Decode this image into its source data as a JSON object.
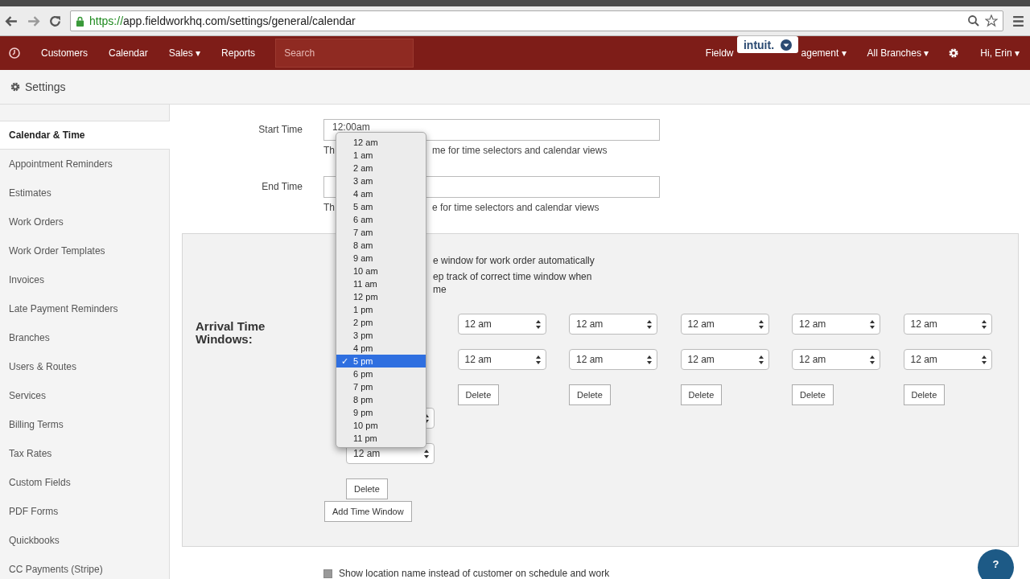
{
  "browser": {
    "url_scheme": "https://",
    "url_rest": "app.fieldworkhq.com/settings/general/calendar"
  },
  "nav": {
    "left": [
      {
        "label": "Customers",
        "caret": false
      },
      {
        "label": "Calendar",
        "caret": false
      },
      {
        "label": "Sales",
        "caret": true
      },
      {
        "label": "Reports",
        "caret": false
      }
    ],
    "search": {
      "placeholder": "Search"
    },
    "covered_left": "Fieldw",
    "covered_right": "agement",
    "right": [
      {
        "label": "All Branches",
        "caret": true
      }
    ],
    "user": "Hi, Erin",
    "caret": "▾",
    "badge": "intuit."
  },
  "header": {
    "title": "Settings"
  },
  "sidebar": {
    "items": [
      {
        "label": "Calendar & Time",
        "selected": true
      },
      {
        "label": "Appointment Reminders",
        "selected": false
      },
      {
        "label": "Estimates",
        "selected": false
      },
      {
        "label": "Work Orders",
        "selected": false
      },
      {
        "label": "Work Order Templates",
        "selected": false
      },
      {
        "label": "Invoices",
        "selected": false
      },
      {
        "label": "Late Payment Reminders",
        "selected": false
      },
      {
        "label": "Branches",
        "selected": false
      },
      {
        "label": "Users & Routes",
        "selected": false
      },
      {
        "label": "Services",
        "selected": false
      },
      {
        "label": "Billing Terms",
        "selected": false
      },
      {
        "label": "Tax Rates",
        "selected": false
      },
      {
        "label": "Custom Fields",
        "selected": false
      },
      {
        "label": "PDF Forms",
        "selected": false
      },
      {
        "label": "Quickbooks",
        "selected": false
      },
      {
        "label": "CC Payments (Stripe)",
        "selected": false
      }
    ]
  },
  "form": [
    {
      "label": "Start Time",
      "value": "12:00am",
      "help_left": "Th",
      "help_right": "me for time selectors and calendar views"
    },
    {
      "label": "End Time",
      "help_left": "Th",
      "help_right": "e for time selectors and calendar views"
    }
  ],
  "arrival": {
    "lines": [
      "e window for work order automatically",
      "ep track of correct time window when",
      "me"
    ],
    "label": "Arrival Time Windows:",
    "windows": [
      {
        "start": "12 am",
        "end": "12 am",
        "delete": "Delete"
      },
      {
        "start": "12 am",
        "end": "12 am",
        "delete": "Delete"
      },
      {
        "start": "12 am",
        "end": "12 am",
        "delete": "Delete"
      },
      {
        "start": "12 am",
        "end": "12 am",
        "delete": "Delete"
      },
      {
        "start": "12 am",
        "end": "12 am",
        "delete": "Delete"
      },
      {
        "end": "12 am",
        "delete": "Delete"
      }
    ],
    "add_button": "Add Time Window"
  },
  "dropdown": {
    "options": [
      {
        "label": "12 am",
        "selected": false
      },
      {
        "label": "1 am",
        "selected": false
      },
      {
        "label": "2 am",
        "selected": false
      },
      {
        "label": "3 am",
        "selected": false
      },
      {
        "label": "4 am",
        "selected": false
      },
      {
        "label": "5 am",
        "selected": false
      },
      {
        "label": "6 am",
        "selected": false
      },
      {
        "label": "7 am",
        "selected": false
      },
      {
        "label": "8 am",
        "selected": false
      },
      {
        "label": "9 am",
        "selected": false
      },
      {
        "label": "10 am",
        "selected": false
      },
      {
        "label": "11 am",
        "selected": false
      },
      {
        "label": "12 pm",
        "selected": false
      },
      {
        "label": "1 pm",
        "selected": false
      },
      {
        "label": "2 pm",
        "selected": false
      },
      {
        "label": "3 pm",
        "selected": false
      },
      {
        "label": "4 pm",
        "selected": false
      },
      {
        "label": "5 pm",
        "selected": true
      },
      {
        "label": "6 pm",
        "selected": false
      },
      {
        "label": "7 pm",
        "selected": false
      },
      {
        "label": "8 pm",
        "selected": false
      },
      {
        "label": "9 pm",
        "selected": false
      },
      {
        "label": "10 pm",
        "selected": false
      },
      {
        "label": "11 pm",
        "selected": false
      }
    ],
    "check": "✓"
  },
  "bottom_option": {
    "label": "Show location name instead of customer on schedule and work",
    "checked": false
  },
  "help_button": {
    "label": "?"
  }
}
